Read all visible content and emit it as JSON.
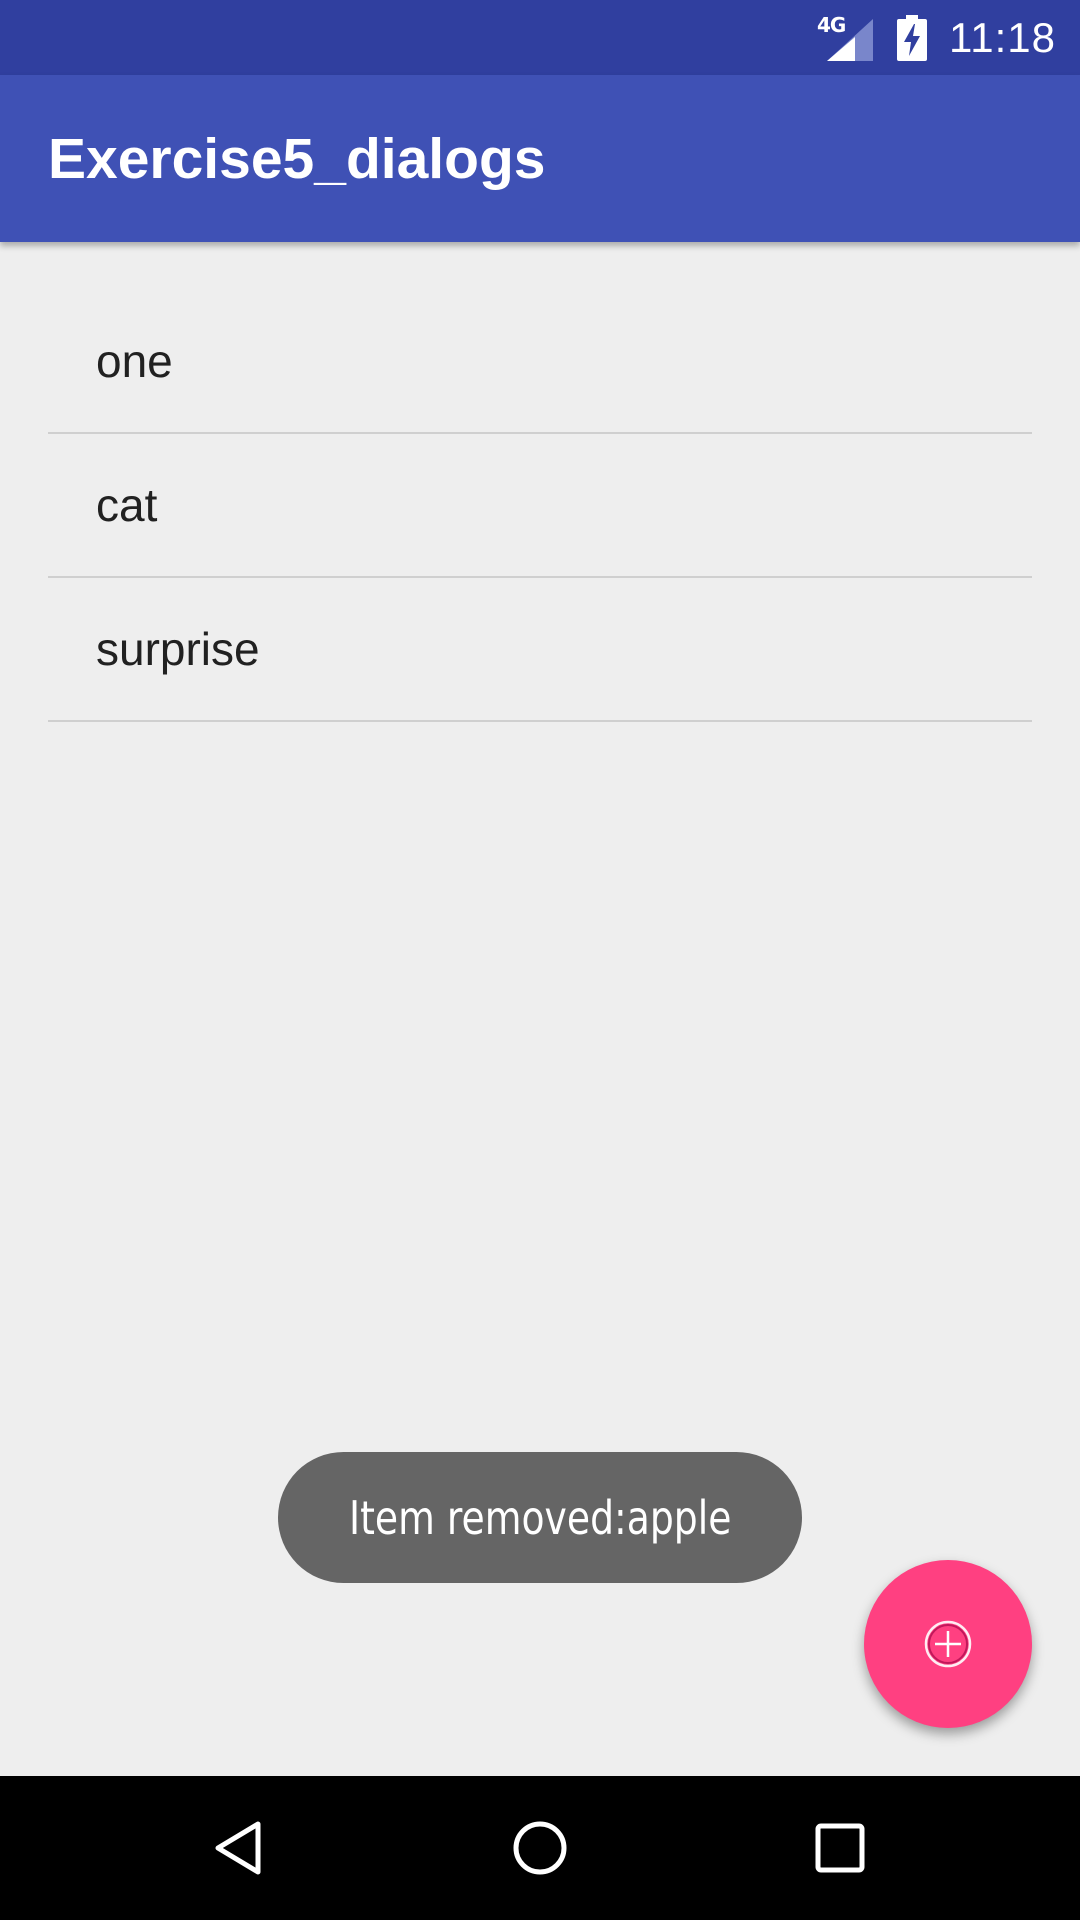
{
  "status_bar": {
    "network_label": "4G",
    "network_icon": "signal-icon",
    "battery_icon": "battery-charging-icon",
    "time": "11:18"
  },
  "app_bar": {
    "title": "Exercise5_dialogs"
  },
  "list": {
    "items": [
      {
        "label": "one"
      },
      {
        "label": "cat"
      },
      {
        "label": "surprise"
      }
    ]
  },
  "toast": {
    "message": "Item removed:apple"
  },
  "fab": {
    "icon": "add-circle-icon"
  },
  "nav_bar": {
    "back_icon": "back-icon",
    "home_icon": "home-icon",
    "recents_icon": "recents-icon"
  },
  "colors": {
    "status_bar": "#303f9f",
    "app_bar": "#3f51b5",
    "background": "#eeeeee",
    "fab": "#ff4081",
    "toast": "#656565",
    "nav_bar": "#000000"
  }
}
